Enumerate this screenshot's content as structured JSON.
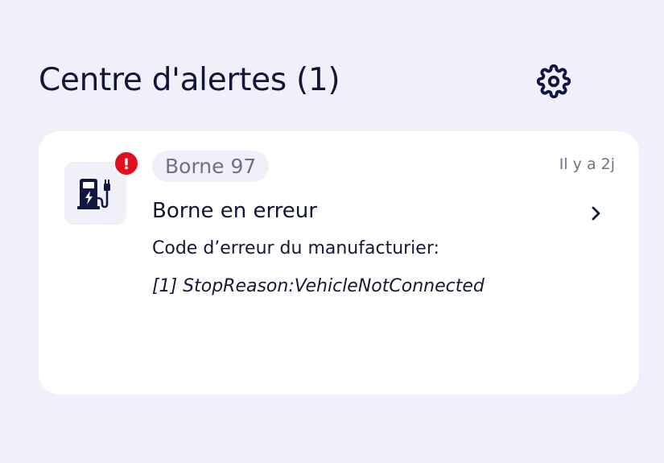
{
  "header": {
    "title": "Centre d'alertes (1)",
    "settings_icon": "gear-icon"
  },
  "alerts": [
    {
      "station": "Borne 97",
      "time_ago": "Il y a 2j",
      "title": "Borne en erreur",
      "description": "Code d’erreur du manufacturier:",
      "code": "[1] StopReason:VehicleNotConnected",
      "icon": "ev-charger-icon",
      "status_icon": "error-badge-icon",
      "status_color": "#e0101e"
    }
  ],
  "colors": {
    "background": "#f1f0fa",
    "card": "#ffffff",
    "text_primary": "#111735",
    "text_muted": "#6c7088",
    "error": "#e0101e"
  }
}
